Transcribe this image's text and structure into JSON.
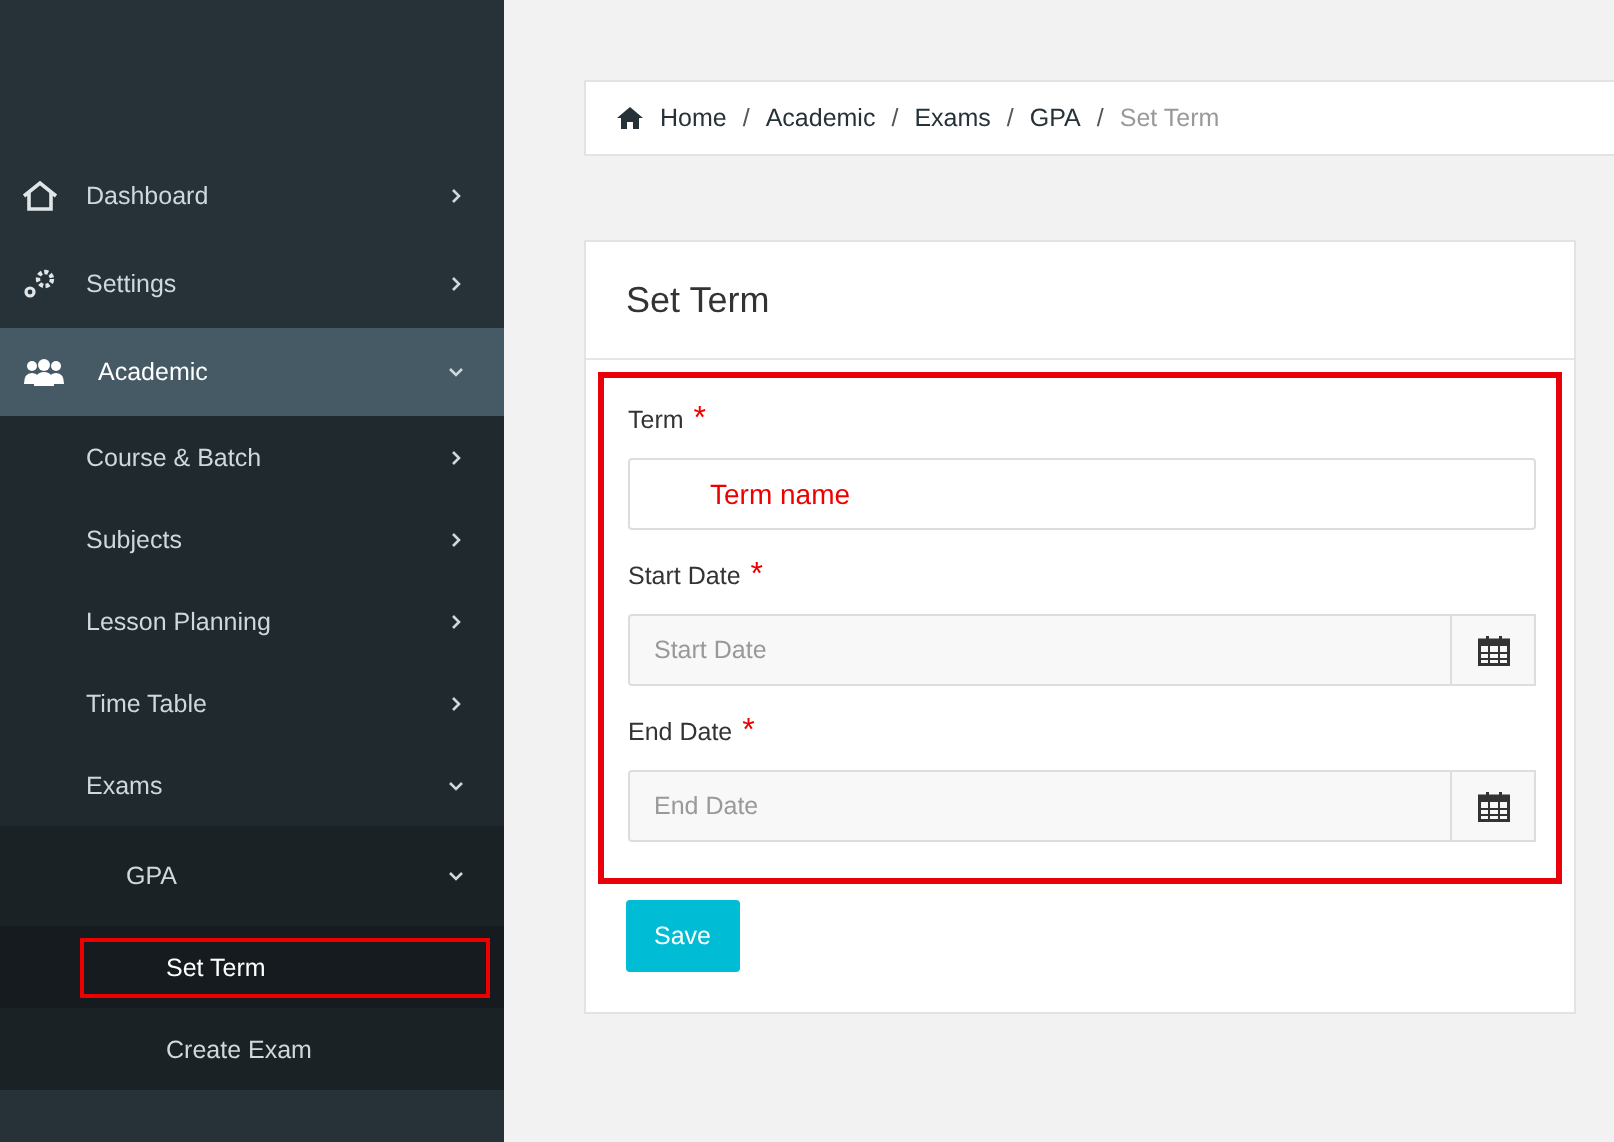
{
  "sidebar": {
    "items": [
      {
        "label": "Dashboard",
        "expanded": false,
        "selected": false
      },
      {
        "label": "Settings",
        "expanded": false,
        "selected": false
      },
      {
        "label": "Academic",
        "expanded": true,
        "selected": true,
        "children": [
          {
            "label": "Course & Batch",
            "expanded": false,
            "selected": false
          },
          {
            "label": "Subjects",
            "expanded": false,
            "selected": false
          },
          {
            "label": "Lesson Planning",
            "expanded": false,
            "selected": false
          },
          {
            "label": "Time Table",
            "expanded": false,
            "selected": false
          },
          {
            "label": "Exams",
            "expanded": true,
            "selected": false,
            "children": [
              {
                "label": "GPA",
                "expanded": true,
                "selected": false,
                "children": [
                  {
                    "label": "Set Term",
                    "selected": true,
                    "highlighted": true
                  },
                  {
                    "label": "Create Exam",
                    "selected": false
                  }
                ]
              }
            ]
          }
        ]
      }
    ]
  },
  "breadcrumb": {
    "separator": "/",
    "items": [
      "Home",
      "Academic",
      "Exams",
      "GPA",
      "Set Term"
    ]
  },
  "panel": {
    "title": "Set Term",
    "highlighted": true,
    "fields": [
      {
        "kind": "text",
        "label": "Term",
        "required_mark": "*",
        "value": "Term name"
      },
      {
        "kind": "date",
        "label": "Start Date",
        "required_mark": "*",
        "placeholder": "Start Date"
      },
      {
        "kind": "date",
        "label": "End Date",
        "required_mark": "*",
        "placeholder": "End Date"
      }
    ],
    "button": "Save"
  }
}
